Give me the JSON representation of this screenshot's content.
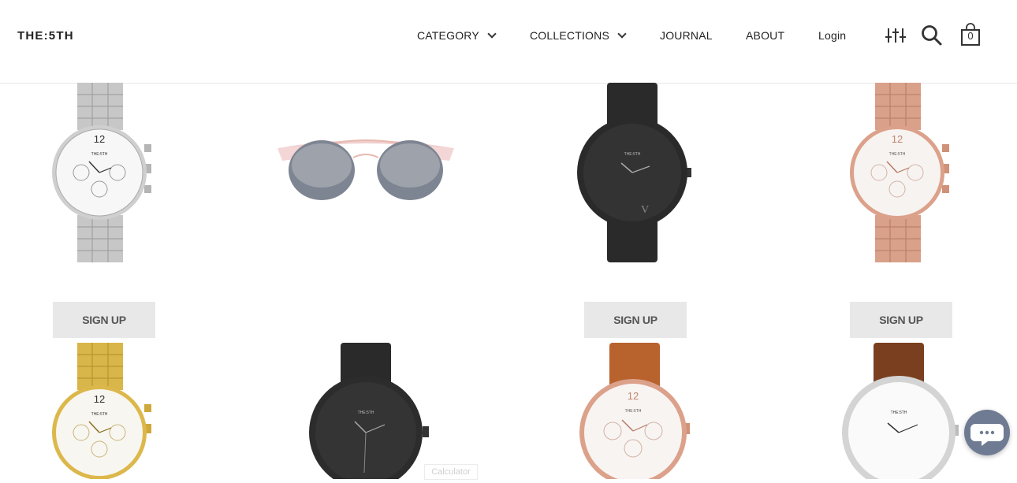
{
  "header": {
    "logo": "THE:5TH",
    "nav": [
      {
        "label": "CATEGORY"
      },
      {
        "label": "COLLECTIONS"
      },
      {
        "label": "JOURNAL"
      },
      {
        "label": "ABOUT"
      },
      {
        "label": "Login"
      }
    ],
    "icons": [
      "filter-icon",
      "search-icon",
      "cart-icon"
    ],
    "cart_count": "0"
  },
  "products_row1": [
    {
      "image": "silver-chronograph-watch",
      "cta": "SIGN UP"
    },
    {
      "image": "pink-sunglasses",
      "cta": ""
    },
    {
      "image": "black-leather-watch",
      "cta": "SIGN UP"
    },
    {
      "image": "rose-gold-chronograph-watch",
      "cta": "SIGN UP"
    }
  ],
  "products_row2": [
    {
      "image": "gold-chronograph-watch"
    },
    {
      "image": "black-matte-watch"
    },
    {
      "image": "rose-gold-brown-leather-watch"
    },
    {
      "image": "silver-brown-leather-watch"
    }
  ],
  "watch_brand": "THE:5TH",
  "tooltip": "Calculator",
  "colors": {
    "silver": "#c9c9c9",
    "rose_gold": "#d9a08a",
    "gold": "#d9b64a",
    "black": "#2a2a2a",
    "chat": "#6f7b92"
  }
}
